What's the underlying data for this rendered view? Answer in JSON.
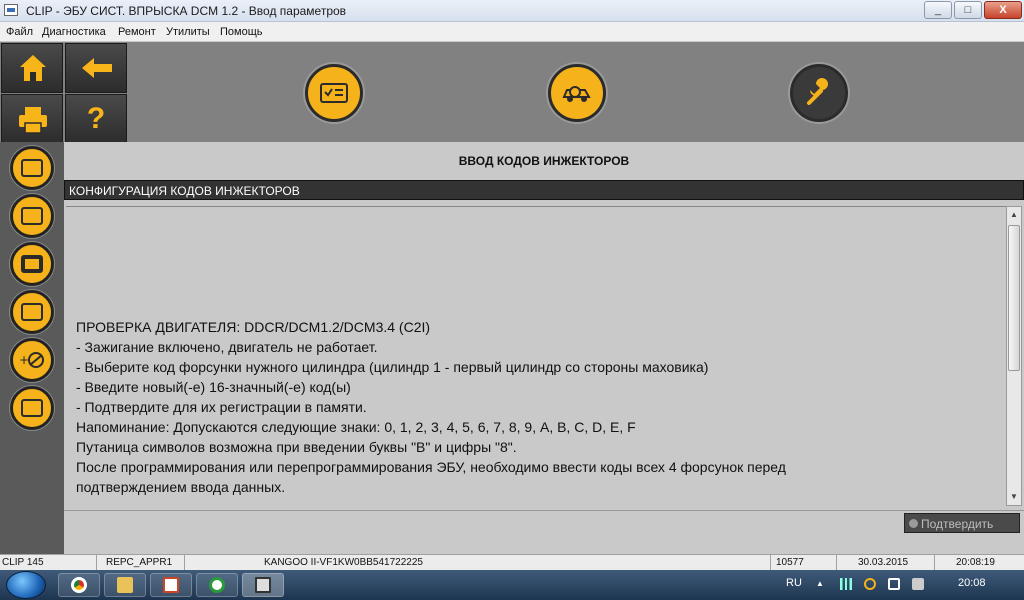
{
  "window": {
    "title": "CLIP - ЭБУ СИСТ. ВПРЫСКА DCM 1.2 - Ввод параметров",
    "min_label": "_",
    "max_label": "□",
    "close_label": "X"
  },
  "menu": [
    "Файл",
    "Диагностика",
    "Ремонт",
    "Утилиты",
    "Помощь"
  ],
  "toolbar": {
    "help_label": "?"
  },
  "page": {
    "title": "ВВОД КОДОВ ИНЖЕКТОРОВ",
    "section_header": "КОНФИГУРАЦИЯ КОДОВ ИНЖЕКТОРОВ",
    "lines": [
      "ПРОВЕРКА ДВИГАТЕЛЯ: DDCR/DCM1.2/DCM3.4 (C2I)",
      "- Зажигание включено, двигатель не работает.",
      "- Выберите код форсунки нужного цилиндра (цилиндр 1 - первый цилиндр со стороны маховика)",
      "- Введите новый(-е) 16-значный(-е) код(ы)",
      "- Подтвердите для их регистрации в памяти.",
      "Напоминание: Допускаются следующие знаки:  0, 1, 2, 3, 4, 5, 6, 7, 8, 9, A, B, C, D, E, F",
      "Путаница символов возможна при введении буквы \"B\" и цифры \"8\".",
      "После программирования или перепрограммирования ЭБУ, необходимо ввести коды всех 4 форсунок перед",
      "подтверждением ввода данных."
    ],
    "confirm_label": "Подтвердить"
  },
  "status": {
    "clip": "CLIP 145",
    "repc": "REPC_APPR1",
    "vehicle": "KANGOO II-VF1KW0BB541722225",
    "code": "10577",
    "date": "30.03.2015",
    "time": "20:08:19"
  },
  "taskbar": {
    "lang": "RU",
    "clock": "20:08"
  },
  "colors": {
    "accent_yellow": "#f5b21b",
    "panel_gray": "#c9c9c9",
    "dark": "#333333"
  }
}
